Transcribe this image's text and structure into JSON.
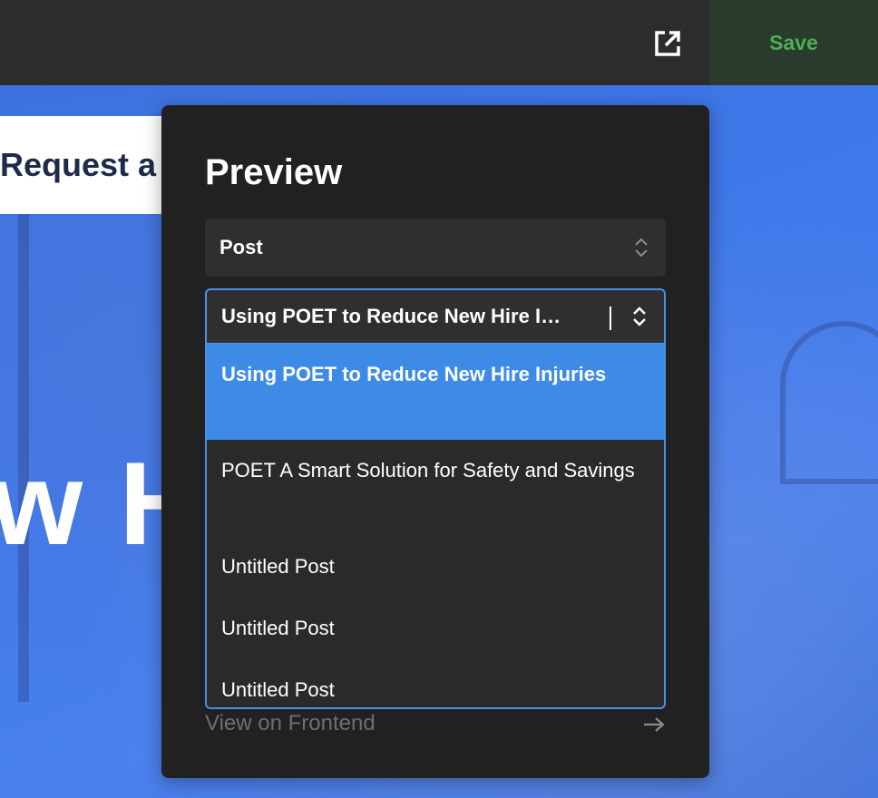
{
  "toolbar": {
    "open_external_icon": "external-link-icon",
    "save_label": "Save",
    "save_color": "#4caf50"
  },
  "canvas": {
    "request_button_text": "Request a",
    "hero_text": "w H",
    "accent_color": "#3f78ea"
  },
  "preview_panel": {
    "title": "Preview",
    "type_select": {
      "value": "Post",
      "icon": "chevron-up-down-icon"
    },
    "post_select": {
      "value": "Using POET to Reduce New Hire I…",
      "icon": "chevron-up-down-icon",
      "options": [
        {
          "label": "Using POET to Reduce New Hire Injuries",
          "selected": true
        },
        {
          "label": "POET A Smart Solution for Safety and Savings",
          "selected": false
        },
        {
          "label": "Untitled Post",
          "selected": false
        },
        {
          "label": "Untitled Post",
          "selected": false
        },
        {
          "label": "Untitled Post",
          "selected": false
        }
      ]
    },
    "frontend_link": {
      "label": "View on Frontend",
      "icon": "arrow-right-icon"
    }
  }
}
